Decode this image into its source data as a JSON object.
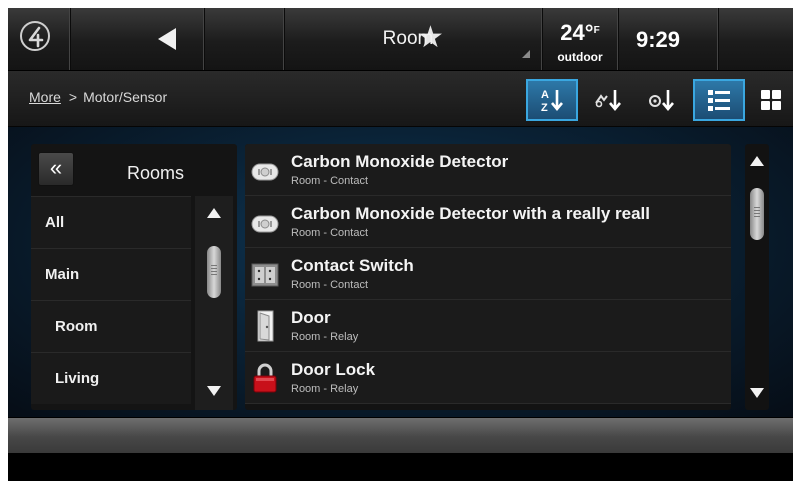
{
  "topbar": {
    "title": "Room",
    "temperature": "24°",
    "temp_unit": "F",
    "weather_label": "outdoor",
    "time": "9:29"
  },
  "subbar": {
    "breadcrumb_link": "More",
    "breadcrumb_separator": ">",
    "breadcrumb_current": "Motor/Sensor",
    "toolbar": [
      {
        "icon": "sort-alpha-icon",
        "active": true
      },
      {
        "icon": "sort-type-icon",
        "active": false
      },
      {
        "icon": "sort-status-icon",
        "active": false
      },
      {
        "icon": "list-view-icon",
        "active": true
      },
      {
        "icon": "grid-view-icon",
        "active": false
      }
    ]
  },
  "rooms": {
    "collapse_label": "«",
    "title": "Rooms",
    "items": [
      {
        "label": "All"
      },
      {
        "label": "Main"
      },
      {
        "label": "Room"
      },
      {
        "label": "Living"
      }
    ]
  },
  "devices": [
    {
      "name": "Carbon Monoxide Detector",
      "sub": "Room - Contact",
      "icon": "co-detector-icon"
    },
    {
      "name": "Carbon Monoxide Detector with a really reall",
      "sub": "Room - Contact",
      "icon": "co-detector-icon"
    },
    {
      "name": "Contact Switch",
      "sub": "Room - Contact",
      "icon": "contact-switch-icon"
    },
    {
      "name": "Door",
      "sub": "Room - Relay",
      "icon": "door-icon"
    },
    {
      "name": "Door Lock",
      "sub": "Room - Relay",
      "icon": "lock-icon"
    }
  ],
  "colors": {
    "accent": "#3aa7e0",
    "lock_red": "#c8101a"
  }
}
